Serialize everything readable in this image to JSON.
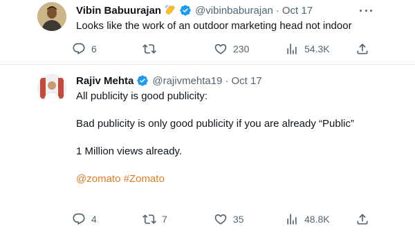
{
  "tweets": [
    {
      "name": "Vibin Babuurajan",
      "handle": "@vibinbaburajan",
      "separator": "·",
      "time": "Oct 17",
      "has_emoji": true,
      "verified": true,
      "text": "Looks like the work of an outdoor marketing head not indoor",
      "stats": {
        "replies": "6",
        "retweets": "",
        "likes": "230",
        "views": "54.3K"
      }
    },
    {
      "name": "Rajiv Mehta",
      "handle": "@rajivmehta19",
      "separator": "·",
      "time": "Oct 17",
      "has_emoji": false,
      "verified": true,
      "paragraphs": [
        "All publicity is good publicity:",
        "Bad publicity is only good publicity if you are already “Public”",
        "1 Million views already."
      ],
      "hashtags": [
        "@zomato",
        "#Zomato"
      ],
      "stats": {
        "replies": "4",
        "retweets": "7",
        "likes": "35",
        "views": "48.8K"
      }
    }
  ],
  "colors": {
    "text": "#0f1419",
    "secondary": "#536471",
    "verified": "#1d9bf0",
    "hashtag": "#e07b24",
    "divider": "#e6e9eb"
  },
  "icons": [
    "reply-icon",
    "retweet-icon",
    "like-icon",
    "views-icon",
    "share-icon",
    "verified-badge-icon",
    "clapping-hands-icon",
    "more-icon"
  ]
}
